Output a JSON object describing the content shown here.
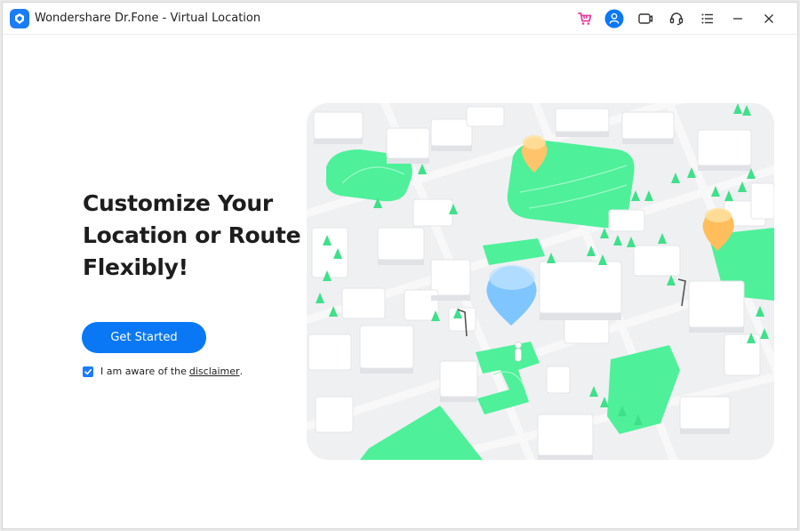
{
  "window": {
    "title": "Wondershare Dr.Fone - Virtual Location"
  },
  "toolbar": {
    "icons": [
      "cart-icon",
      "user-icon",
      "screen-record-icon",
      "headset-icon",
      "menu-icon",
      "minimize-icon",
      "close-icon"
    ]
  },
  "hero": {
    "title_line1": "Customize Your",
    "title_line2": "Location or Route",
    "title_line3": "Flexibly!",
    "cta_label": "Get Started",
    "consent_text": "I am aware of the",
    "disclaimer_link": "disclaimer",
    "consent_suffix": ".",
    "consent_checked": true
  },
  "colors": {
    "accent": "#0a78f5",
    "cart": "#e8399a",
    "park_green": "#4ef09a",
    "pin_orange": "#ffc46b",
    "pin_blue": "#7fc5ff"
  }
}
